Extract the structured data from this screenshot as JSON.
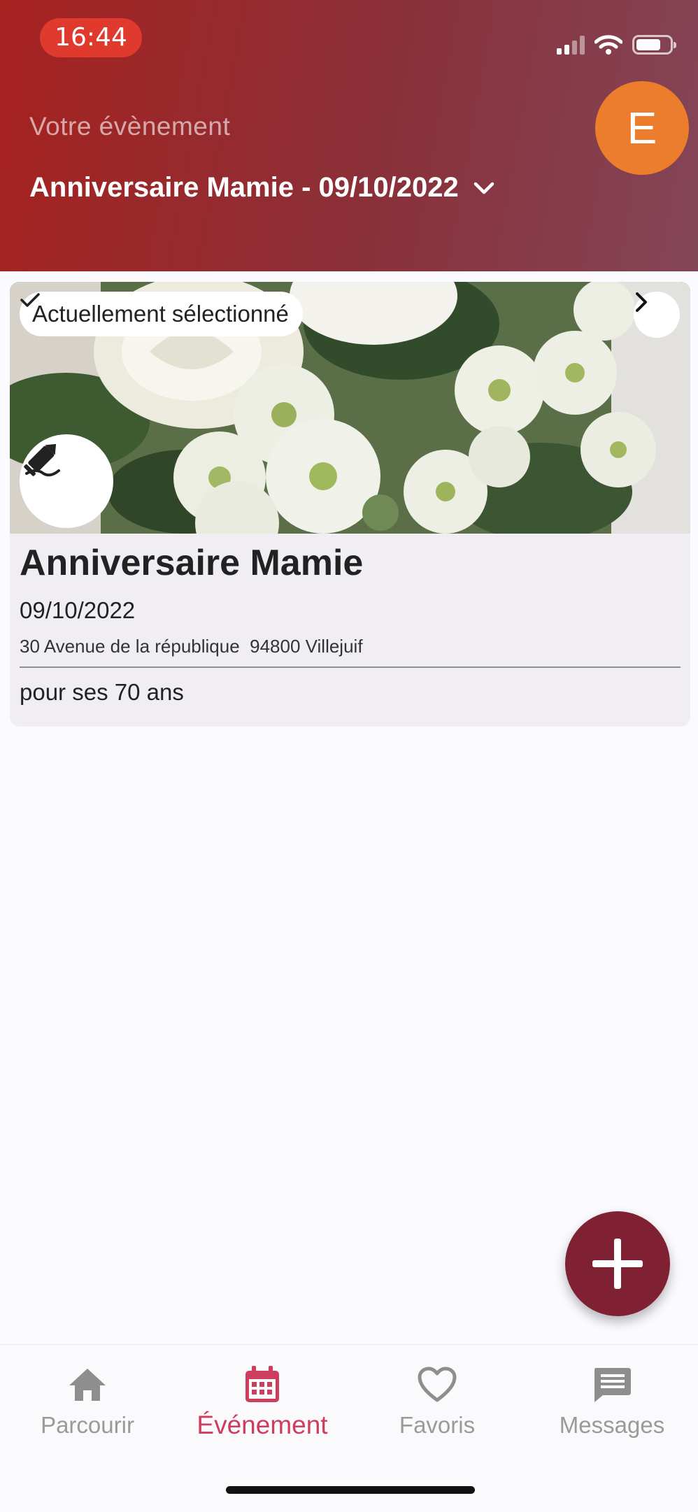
{
  "status_bar": {
    "time": "16:44"
  },
  "header": {
    "caption": "Votre évènement",
    "selected_event": "Anniversaire Mamie - 09/10/2022",
    "avatar_initial": "E"
  },
  "event_card": {
    "badge": "Actuellement sélectionné",
    "title": "Anniversaire Mamie",
    "date": "09/10/2022",
    "address": "30 Avenue de la république  94800 Villejuif",
    "description": "pour ses 70 ans"
  },
  "tabs": [
    {
      "label": "Parcourir",
      "icon": "home-icon",
      "active": false
    },
    {
      "label": "Événement",
      "icon": "calendar-icon",
      "active": true
    },
    {
      "label": "Favoris",
      "icon": "heart-icon",
      "active": false
    },
    {
      "label": "Messages",
      "icon": "message-icon",
      "active": false
    }
  ],
  "colors": {
    "header_start": "#a6221f",
    "header_end": "#834658",
    "avatar": "#ec7d2c",
    "fab": "#7f2133",
    "active_tab": "#cd3e5e",
    "inactive_tab": "#9a9a9a"
  }
}
